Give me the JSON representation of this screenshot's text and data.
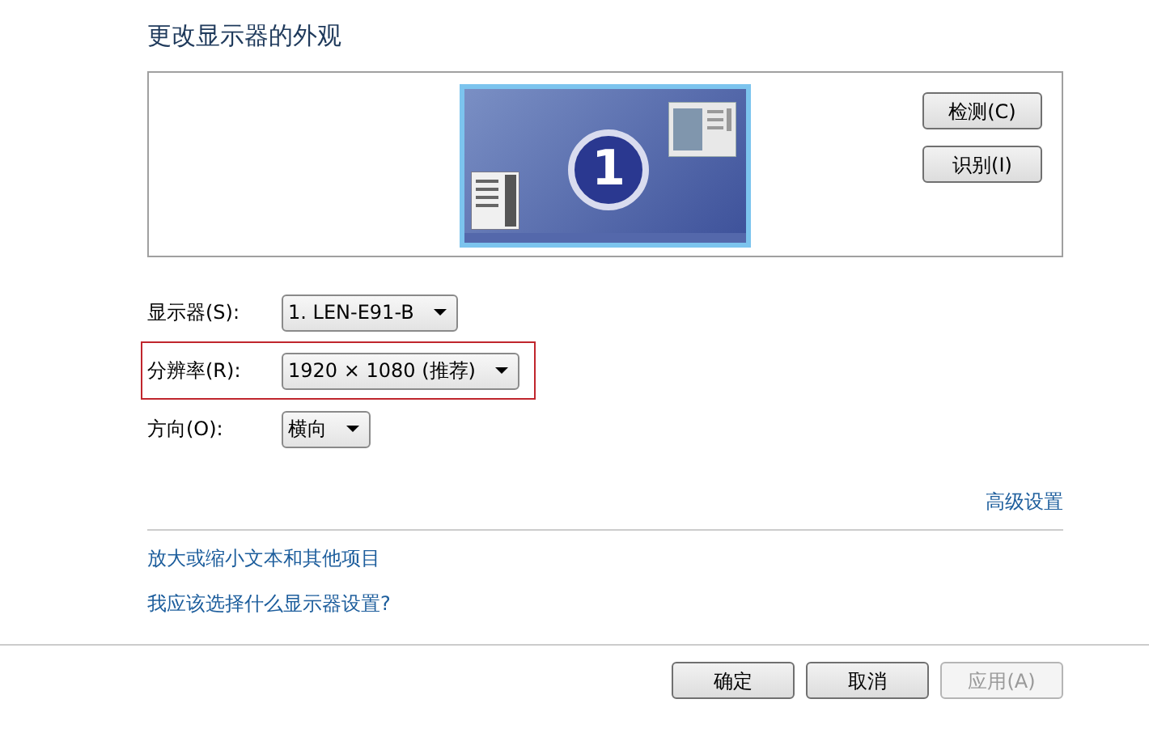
{
  "title": "更改显示器的外观",
  "preview": {
    "monitor_number": "1",
    "side_buttons": [
      {
        "label": "检测(C)"
      },
      {
        "label": "识别(I)"
      }
    ]
  },
  "settings": [
    {
      "label": "显示器(S):",
      "value": "1. LEN-E91-B",
      "highlighted": false
    },
    {
      "label": "分辨率(R):",
      "value": "1920 × 1080 (推荐)",
      "highlighted": true
    },
    {
      "label": "方向(O):",
      "value": "横向",
      "highlighted": false
    }
  ],
  "advanced_link": "高级设置",
  "links": [
    "放大或缩小文本和其他项目",
    "我应该选择什么显示器设置?"
  ],
  "footer_buttons": [
    {
      "label": "确定",
      "disabled": false
    },
    {
      "label": "取消",
      "disabled": false
    },
    {
      "label": "应用(A)",
      "disabled": true
    }
  ]
}
